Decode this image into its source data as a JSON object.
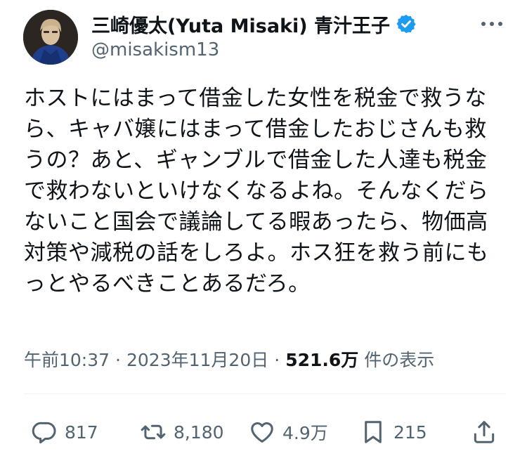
{
  "author": {
    "display_name": "三崎優太(Yuta Misaki) 青汁王子",
    "handle": "@misakism13",
    "verified": true
  },
  "tweet": {
    "lines": [
      "ホストにはまって借金した女性を税金で救うな",
      "ら、キャバ嬢にはまって借金したおじさんも救",
      "うの？あと、ギャンブルで借金した人達も税金",
      "で救わないといけなくなるよね。そんなくだら",
      "ないこと国会で議論してる暇あったら、物価高",
      "対策や減税の話をしろよ。ホス狂を救う前にも",
      "っとやるべきことあるだろ。"
    ]
  },
  "meta": {
    "time": "午前10:37",
    "separator": "·",
    "date": "2023年11月20日",
    "views_count": "521.6万",
    "views_label": "件の表示"
  },
  "actions": {
    "reply_count": "817",
    "repost_count": "8,180",
    "like_count": "4.9万",
    "bookmark_count": "215"
  },
  "colors": {
    "text": "#0f1419",
    "secondary": "#536471",
    "verified": "#1d9bf0"
  },
  "icons": [
    "more-icon",
    "verified-badge-icon",
    "reply-icon",
    "repost-icon",
    "like-icon",
    "bookmark-icon",
    "share-icon"
  ]
}
